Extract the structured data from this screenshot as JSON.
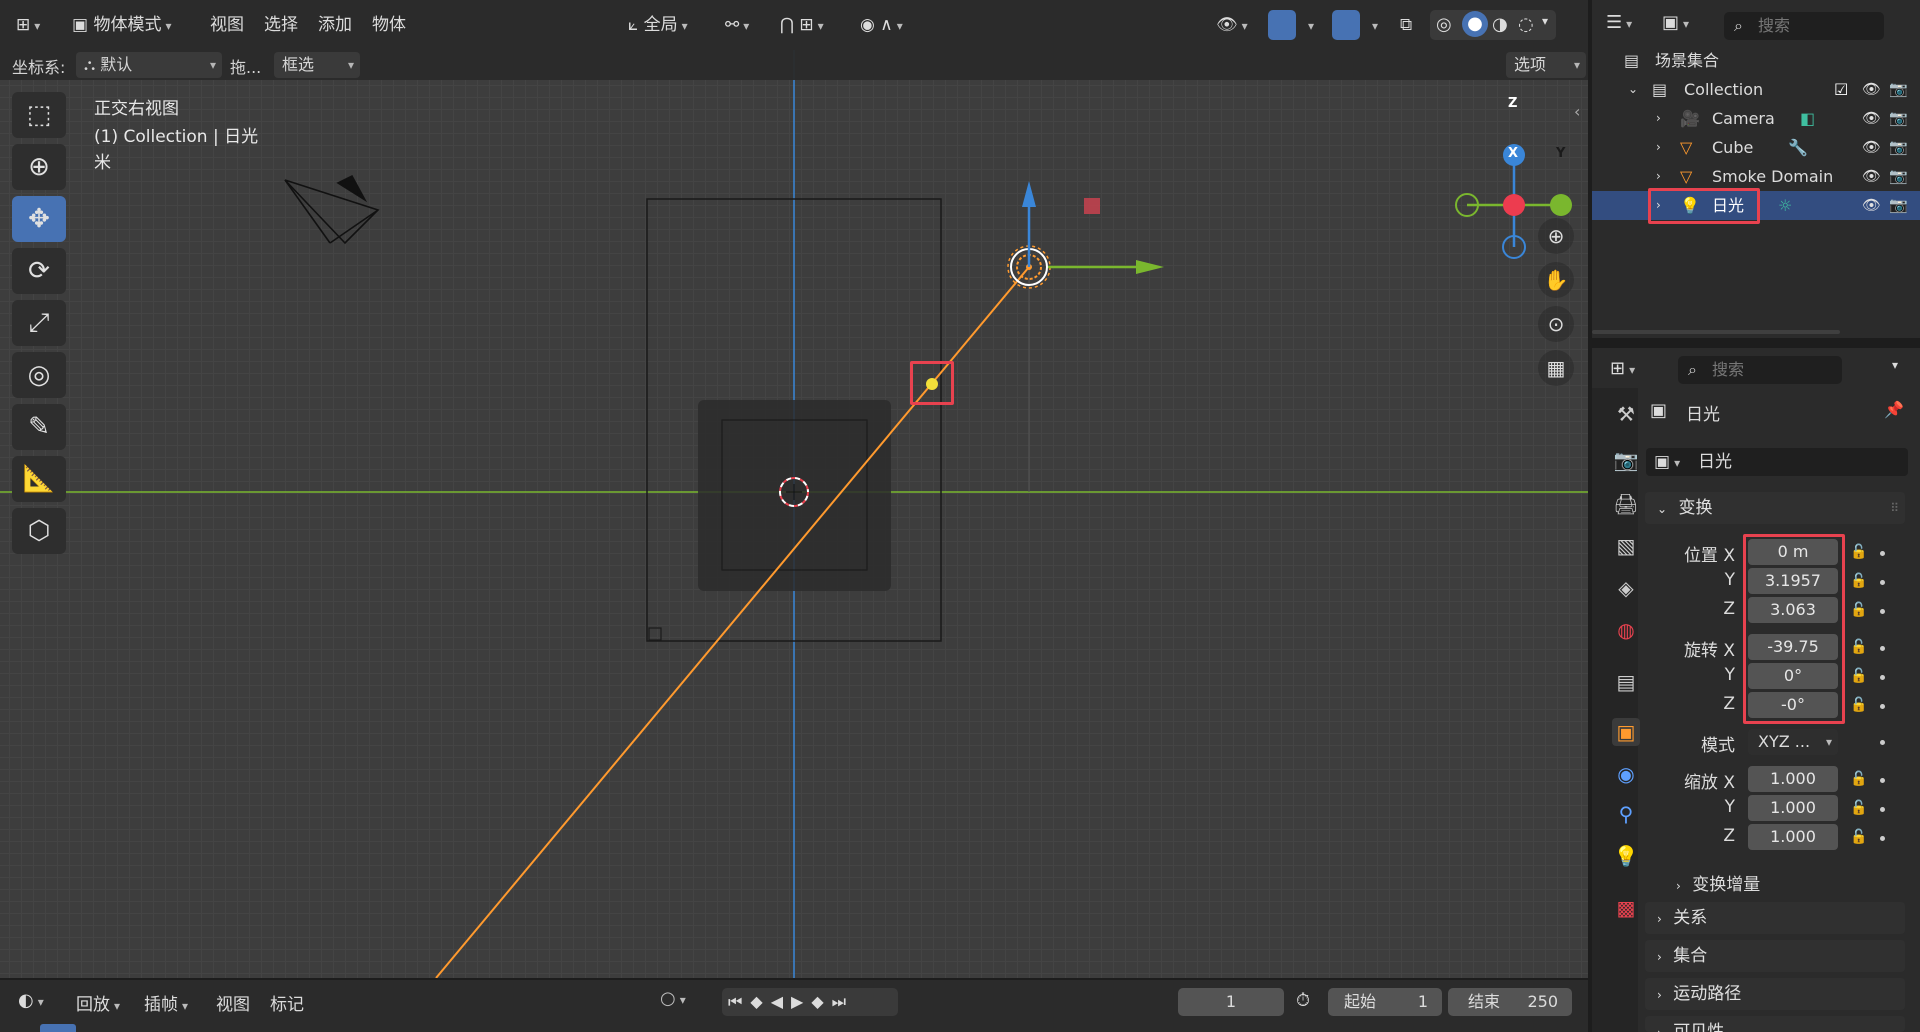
{
  "header": {
    "mode": "物体模式",
    "menus": [
      "视图",
      "选择",
      "添加",
      "物体"
    ],
    "orientation": "全局",
    "coord_label": "坐标系:",
    "coord_value": "默认",
    "drag_label": "拖...",
    "select_mode": "框选",
    "options": "选项"
  },
  "viewport": {
    "view_name": "正交右视图",
    "collection_info": "(1) Collection | 日光",
    "unit": "米",
    "gizmo": {
      "z": "Z",
      "x": "X",
      "y": "Y"
    }
  },
  "outliner": {
    "search_placeholder": "搜索",
    "scene_collection": "场景集合",
    "items": [
      {
        "name": "Collection",
        "type": "collection"
      },
      {
        "name": "Camera",
        "type": "camera"
      },
      {
        "name": "Cube",
        "type": "mesh"
      },
      {
        "name": "Smoke Domain",
        "type": "mesh"
      },
      {
        "name": "日光",
        "type": "light",
        "selected": true
      }
    ]
  },
  "properties": {
    "search_placeholder": "搜索",
    "object_name": "日光",
    "object_field": "日光",
    "transform_title": "变换",
    "location_label": "位置 X",
    "location": [
      "0 m",
      "3.1957",
      "3.063"
    ],
    "rotation_label": "旋转 X",
    "rotation": [
      "-39.75",
      "0°",
      "-0°"
    ],
    "mode_label": "模式",
    "mode_value": "XYZ ...",
    "scale_label": "缩放 X",
    "scale": [
      "1.000",
      "1.000",
      "1.000"
    ],
    "axis_y": "Y",
    "axis_z": "Z",
    "delta_transform": "变换增量",
    "sections": [
      "关系",
      "集合",
      "运动路径",
      "可见性"
    ]
  },
  "timeline": {
    "playback": "回放",
    "keying": "插帧",
    "view": "视图",
    "marker": "标记",
    "current_frame": "1",
    "start_label": "起始",
    "start": "1",
    "end_label": "结束",
    "end": "250"
  },
  "colors": {
    "accent": "#4772b3",
    "highlight": "#e8424f",
    "light_line": "#ff9a2e",
    "x_axis": "#ed3c4f",
    "y_axis": "#7ab72e",
    "z_axis": "#3a86d8"
  }
}
